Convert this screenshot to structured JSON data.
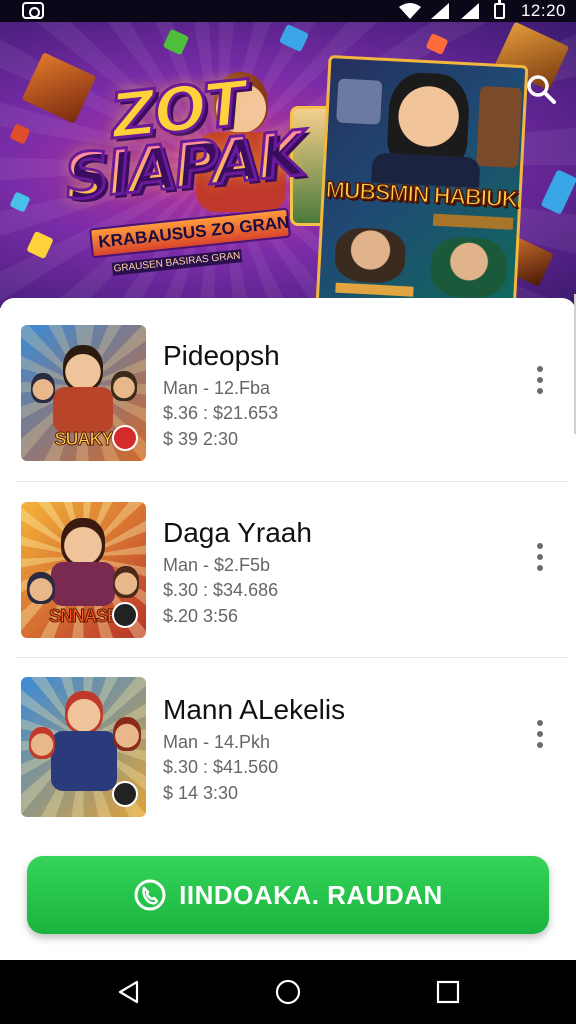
{
  "status_bar": {
    "time": "12:20"
  },
  "hero": {
    "logo_word_1": "ZOT",
    "logo_word_2": "SIAPAK",
    "logo_tagline": "KRABAUSUS ZO GRAN",
    "logo_subline": "GRAUSEN BASIRAS GRAN",
    "poster_title": "MUBSMIN HABIUK"
  },
  "list": {
    "items": [
      {
        "title": "Pideopsh",
        "line1": "Man - 12.Fba",
        "line2": "$.36 : $21.653",
        "line3": "$ 39 2:30",
        "thumb_banner": "SUAKY"
      },
      {
        "title": "Daga Yraah",
        "line1": "Man - $2.F5b",
        "line2": "$.30 : $34.686",
        "line3": "$.20 3:56",
        "thumb_banner": "SNNASE"
      },
      {
        "title": "Mann ALekelis",
        "line1": "Man - 14.Pkh",
        "line2": "$.30 : $41.560",
        "line3": "$ 14 3:30",
        "thumb_banner": ""
      }
    ]
  },
  "cta": {
    "label": "IINDOAKA. RAUDAN"
  },
  "colors": {
    "accent": "#1fbf46",
    "hero_bg": "#7a2ca8",
    "status_bar": "#0b0718"
  },
  "icons": [
    "camera-icon",
    "wifi-icon",
    "signal-icon",
    "battery-icon",
    "search-icon",
    "more-vert-icon",
    "phone-icon",
    "back-icon",
    "home-icon",
    "recents-icon"
  ]
}
